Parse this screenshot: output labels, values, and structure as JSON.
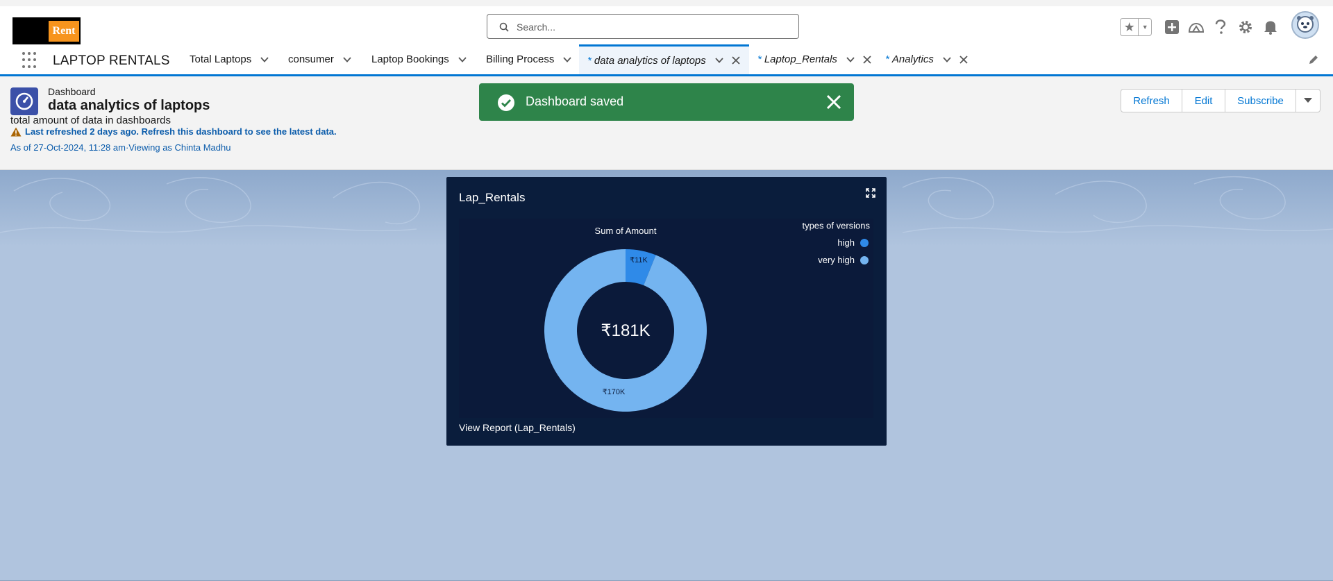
{
  "brand": {
    "logo_text": "Rent"
  },
  "search": {
    "placeholder": "Search..."
  },
  "app": {
    "name": "LAPTOP RENTALS"
  },
  "tabs": [
    {
      "label": "Total Laptops"
    },
    {
      "label": "consumer"
    },
    {
      "label": "Laptop Bookings"
    },
    {
      "label": "Billing Process"
    },
    {
      "label": "data analytics of laptops",
      "prefix": "*"
    },
    {
      "label": "Laptop_Rentals",
      "prefix": "*"
    },
    {
      "label": "Analytics",
      "prefix": "*"
    }
  ],
  "header": {
    "object_type": "Dashboard",
    "title": "data analytics of laptops",
    "description": "total amount of data in dashboards",
    "warning": "Last refreshed 2 days ago. Refresh this dashboard to see the latest data.",
    "as_of": "As of 27-Oct-2024, 11:28 am·Viewing as Chinta Madhu"
  },
  "buttons": {
    "refresh": "Refresh",
    "edit": "Edit",
    "subscribe": "Subscribe"
  },
  "toast": {
    "message": "Dashboard saved"
  },
  "widget": {
    "title": "Lap_Rentals",
    "footer": "View Report (Lap_Rentals)"
  },
  "chart_data": {
    "type": "pie",
    "title": "Sum of Amount",
    "center_label": "₹181K",
    "legend_title": "types of versions",
    "legend_position": "top-right",
    "slices": [
      {
        "name": "high",
        "value": 11,
        "label": "₹11K",
        "color": "#2f8ae8"
      },
      {
        "name": "very high",
        "value": 170,
        "label": "₹170K",
        "color": "#74b4f0"
      }
    ]
  },
  "colors": {
    "brand_blue": "#0176d3",
    "toast_green": "#2e844a",
    "widget_bg": "#0a1d3c"
  }
}
